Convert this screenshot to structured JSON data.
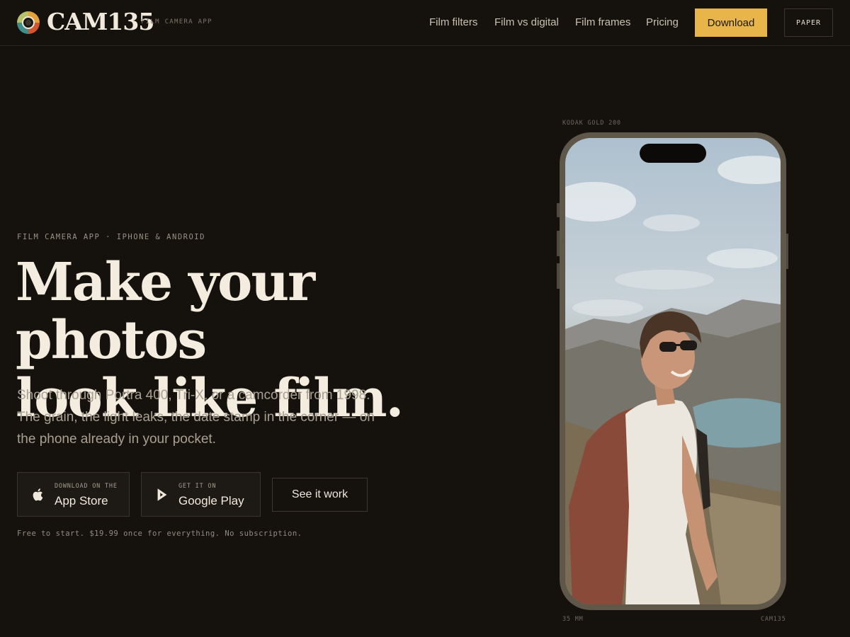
{
  "header": {
    "brand": "CAM135",
    "brand_tag": "FILM CAMERA APP",
    "nav": [
      "Film filters",
      "Film vs digital",
      "Film frames",
      "Pricing"
    ],
    "download_label": "Download",
    "paper_label": "PAPER"
  },
  "hero": {
    "eyebrow": "FILM CAMERA APP · IPHONE & ANDROID",
    "headline_line1": "Make your photos",
    "headline_line2": "look like film.",
    "subtext": "Shoot through Portra 400, Tri-X, or a camcorder from 1998. The grain, the light leaks, the date stamp in the corner — on the phone already in your pocket.",
    "app_store": {
      "small": "DOWNLOAD ON THE",
      "big": "App Store",
      "icon": "apple-icon"
    },
    "google_play": {
      "small": "GET IT ON",
      "big": "Google Play",
      "icon": "play-icon"
    },
    "see_it_work": "See it work",
    "fine_print": "Free to start. $19.99 once for everything. No subscription."
  },
  "phone": {
    "caption_top": "KODAK GOLD 200",
    "caption_bottom_left": "35 MM",
    "caption_bottom_right": "CAM135"
  },
  "colors": {
    "background": "#15120e",
    "accent": "#e8b54a",
    "text": "#efe7da"
  }
}
